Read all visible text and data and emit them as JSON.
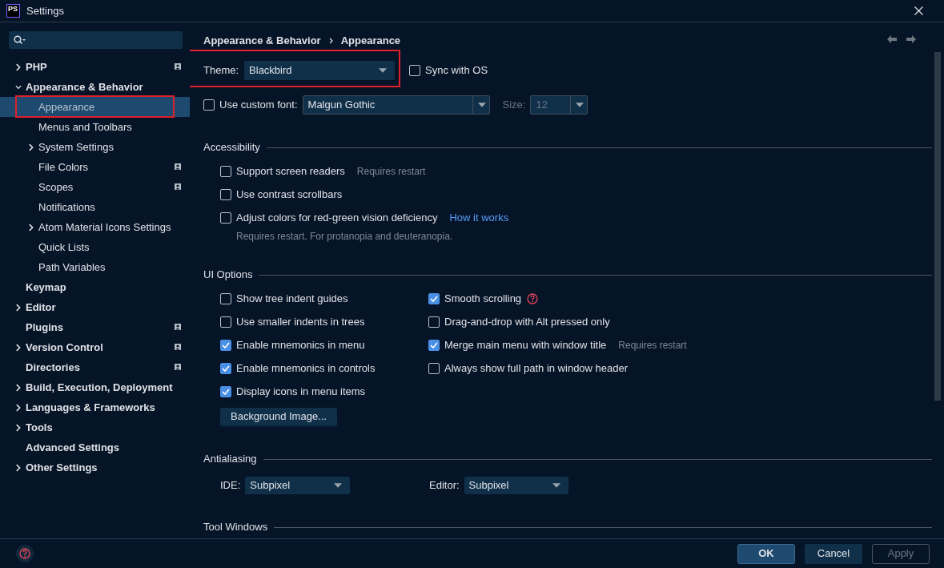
{
  "window": {
    "title": "Settings",
    "logo": "PS"
  },
  "sidebar": {
    "items": [
      {
        "label": "PHP",
        "expandable": true,
        "expanded": false,
        "selected": false,
        "project_scoped": true,
        "highlighted": false
      },
      {
        "label": "Appearance & Behavior",
        "expandable": true,
        "expanded": true,
        "selected": false,
        "project_scoped": false,
        "highlighted": false,
        "children": [
          {
            "label": "Appearance",
            "expandable": false,
            "selected": true,
            "project_scoped": false,
            "highlighted": true
          },
          {
            "label": "Menus and Toolbars",
            "expandable": false,
            "selected": false,
            "project_scoped": false,
            "highlighted": false
          },
          {
            "label": "System Settings",
            "expandable": true,
            "expanded": false,
            "selected": false,
            "project_scoped": false,
            "highlighted": false
          },
          {
            "label": "File Colors",
            "expandable": false,
            "selected": false,
            "project_scoped": true,
            "highlighted": false
          },
          {
            "label": "Scopes",
            "expandable": false,
            "selected": false,
            "project_scoped": true,
            "highlighted": false
          },
          {
            "label": "Notifications",
            "expandable": false,
            "selected": false,
            "project_scoped": false,
            "highlighted": false
          },
          {
            "label": "Atom Material Icons Settings",
            "expandable": true,
            "expanded": false,
            "selected": false,
            "project_scoped": false,
            "highlighted": false
          },
          {
            "label": "Quick Lists",
            "expandable": false,
            "selected": false,
            "project_scoped": false,
            "highlighted": false
          },
          {
            "label": "Path Variables",
            "expandable": false,
            "selected": false,
            "project_scoped": false,
            "highlighted": false
          }
        ]
      },
      {
        "label": "Keymap",
        "expandable": false,
        "selected": false,
        "project_scoped": false,
        "highlighted": false
      },
      {
        "label": "Editor",
        "expandable": true,
        "expanded": false,
        "selected": false,
        "project_scoped": false,
        "highlighted": false
      },
      {
        "label": "Plugins",
        "expandable": false,
        "selected": false,
        "project_scoped": true,
        "highlighted": false
      },
      {
        "label": "Version Control",
        "expandable": true,
        "expanded": false,
        "selected": false,
        "project_scoped": true,
        "highlighted": false
      },
      {
        "label": "Directories",
        "expandable": false,
        "selected": false,
        "project_scoped": true,
        "highlighted": false
      },
      {
        "label": "Build, Execution, Deployment",
        "expandable": true,
        "expanded": false,
        "selected": false,
        "project_scoped": false,
        "highlighted": false
      },
      {
        "label": "Languages & Frameworks",
        "expandable": true,
        "expanded": false,
        "selected": false,
        "project_scoped": false,
        "highlighted": false
      },
      {
        "label": "Tools",
        "expandable": true,
        "expanded": false,
        "selected": false,
        "project_scoped": false,
        "highlighted": false
      },
      {
        "label": "Advanced Settings",
        "expandable": false,
        "selected": false,
        "project_scoped": false,
        "highlighted": false
      },
      {
        "label": "Other Settings",
        "expandable": true,
        "expanded": false,
        "selected": false,
        "project_scoped": false,
        "highlighted": false
      }
    ]
  },
  "breadcrumb": [
    "Appearance & Behavior",
    "Appearance"
  ],
  "theme": {
    "label": "Theme:",
    "value": "Blackbird",
    "highlighted": true
  },
  "sync_with_os": {
    "label": "Sync with OS",
    "checked": false
  },
  "custom_font": {
    "label": "Use custom font:",
    "checked": false,
    "value": "Malgun Gothic",
    "size_label": "Size:",
    "size_value": "12",
    "size_disabled": true
  },
  "sections": [
    {
      "title": "Accessibility",
      "kind": "list",
      "options": [
        {
          "label": "Support screen readers",
          "checked": false,
          "note": "Requires restart"
        },
        {
          "label": "Use contrast scrollbars",
          "checked": false
        },
        {
          "label": "Adjust colors for red-green vision deficiency",
          "checked": false,
          "link": "How it works",
          "hint": "Requires restart. For protanopia and deuteranopia."
        }
      ]
    },
    {
      "title": "UI Options",
      "kind": "columns",
      "columns": [
        [
          {
            "label": "Show tree indent guides",
            "checked": false
          },
          {
            "label": "Use smaller indents in trees",
            "checked": false
          },
          {
            "label": "Enable mnemonics in menu",
            "checked": true
          },
          {
            "label": "Enable mnemonics in controls",
            "checked": true
          },
          {
            "label": "Display icons in menu items",
            "checked": true
          }
        ],
        [
          {
            "label": "Smooth scrolling",
            "checked": true,
            "help": true
          },
          {
            "label": "Drag-and-drop with Alt pressed only",
            "checked": false
          },
          {
            "label": "Merge main menu with window title",
            "checked": true,
            "note": "Requires restart"
          },
          {
            "label": "Always show full path in window header",
            "checked": false
          }
        ]
      ],
      "button": "Background Image..."
    },
    {
      "title": "Antialiasing",
      "kind": "dropdowns",
      "dropdowns": [
        {
          "label": "IDE:",
          "value": "Subpixel"
        },
        {
          "label": "Editor:",
          "value": "Subpixel"
        }
      ]
    },
    {
      "title": "Tool Windows",
      "kind": "header"
    }
  ],
  "footer": {
    "buttons": [
      {
        "label": "OK",
        "kind": "primary",
        "disabled": false
      },
      {
        "label": "Cancel",
        "kind": "secondary",
        "disabled": false
      },
      {
        "label": "Apply",
        "kind": "secondary",
        "disabled": true
      }
    ]
  }
}
